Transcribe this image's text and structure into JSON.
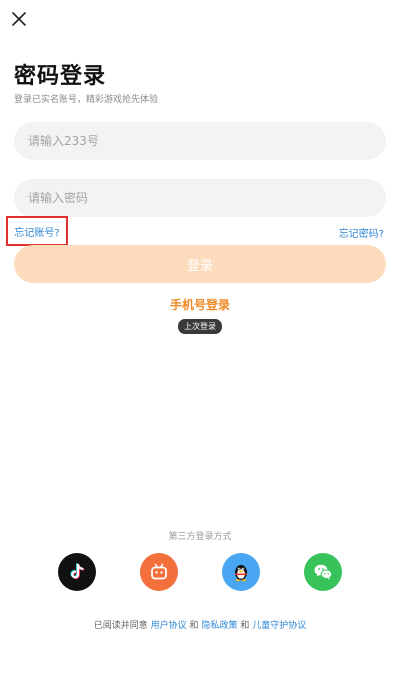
{
  "header": {
    "title": "密码登录",
    "subtitle": "登录已实名账号，精彩游戏抢先体验"
  },
  "form": {
    "account_placeholder": "请输入233号",
    "password_placeholder": "请输入密码",
    "forgot_account": "忘记账号?",
    "forgot_password": "忘记密码?",
    "login_button": "登录"
  },
  "alt_login": {
    "phone_login": "手机号登录",
    "last_login_badge": "上次登录"
  },
  "third_party": {
    "title": "第三方登录方式",
    "providers": [
      {
        "name": "tiktok",
        "color": "#111111"
      },
      {
        "name": "bilibili",
        "color": "#f36f3b"
      },
      {
        "name": "qq",
        "color": "#4aa6f3"
      },
      {
        "name": "wechat",
        "color": "#37c35a"
      }
    ]
  },
  "agreement": {
    "prefix": "已阅读并同意",
    "user_agreement": "用户协议",
    "and1": "和",
    "privacy_policy": "隐私政策",
    "and2": "和",
    "child_protection": "儿童守护协议"
  },
  "colors": {
    "accent_orange": "#f08a24",
    "login_button_disabled": "#fddcbd",
    "link_blue": "#2f86d6",
    "highlight_red": "#e23131"
  }
}
